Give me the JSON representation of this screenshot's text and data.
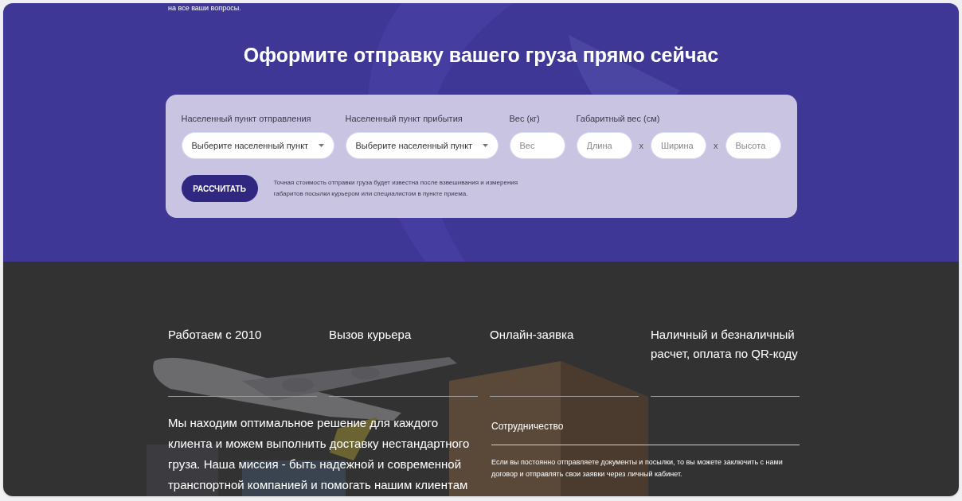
{
  "top_note": "на все ваши вопросы.",
  "heading": "Оформите отправку вашего груза прямо сейчас",
  "form": {
    "fields": [
      {
        "kind": "select",
        "label": "Населенный пункт отправления",
        "value": "Выберите населенный пункт"
      },
      {
        "kind": "select",
        "label": "Населенный пункт прибытия",
        "value": "Выберите населенный пункт"
      },
      {
        "kind": "input",
        "label": "Вес (кг)",
        "placeholder": "Вес"
      },
      {
        "kind": "dimensions",
        "label": "Габаритный вес (см)",
        "parts": [
          {
            "placeholder": "Длина"
          },
          {
            "placeholder": "Ширина"
          },
          {
            "placeholder": "Высота"
          }
        ],
        "separators": [
          "x",
          "x"
        ]
      }
    ],
    "button": "РАССЧИТАТЬ",
    "note": "Точная стоимость отправки груза будет известна после взвешивания и измерения габаритов посылки курьером или специалистом в пункте приема."
  },
  "features": [
    "Работаем с 2010",
    "Вызов курьера",
    "Онлайн-заявка",
    "Наличный и безналичный расчет, оплата по QR-коду"
  ],
  "mission": "Мы находим оптимальное решение для каждого клиента и можем выполнить доставку нестандартного груза. Наша миссия - быть надежной и современной транспортной компанией и помогать нашим клиентам",
  "cooperation": {
    "title": "Сотрудничество",
    "text": "Если вы постоянно отправляете документы и посылки, то вы можете заключить с нами договор и отправлять свои заявки через личный кабинет."
  }
}
